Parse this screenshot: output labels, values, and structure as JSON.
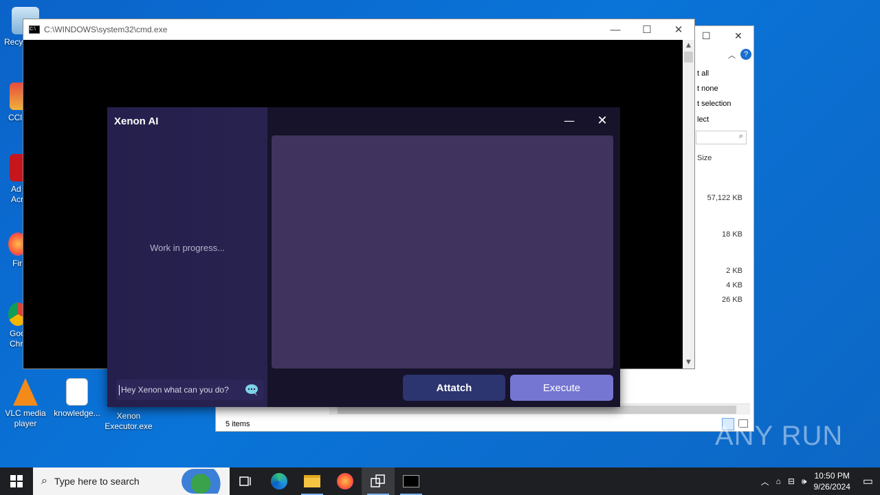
{
  "desktop": {
    "icons": [
      {
        "label": "Recy"
      },
      {
        "label": "CCl"
      },
      {
        "label": "Ad Acr"
      },
      {
        "label": "Fir"
      },
      {
        "label": "Goo Chr"
      },
      {
        "label": "VLC media player"
      },
      {
        "label": "knowledge..."
      },
      {
        "label": "Xenon Executor.exe"
      }
    ]
  },
  "explorer": {
    "ribbon": [
      "t all",
      "t none",
      "t selection",
      "lect"
    ],
    "column_size": "Size",
    "sizes": [
      "57,122 KB",
      "18 KB",
      "2 KB",
      "4 KB",
      "26 KB"
    ],
    "status": "5 items"
  },
  "cmd": {
    "title": "C:\\WINDOWS\\system32\\cmd.exe"
  },
  "xenon": {
    "title": "Xenon AI",
    "sidebar_text": "Work in progress...",
    "prompt_placeholder": "Hey Xenon what can you do?",
    "attach_label": "Attatch",
    "execute_label": "Execute"
  },
  "watermark": {
    "text": "ANY RUN"
  },
  "taskbar": {
    "search_placeholder": "Type here to search",
    "time": "10:50 PM",
    "date": "9/26/2024"
  }
}
